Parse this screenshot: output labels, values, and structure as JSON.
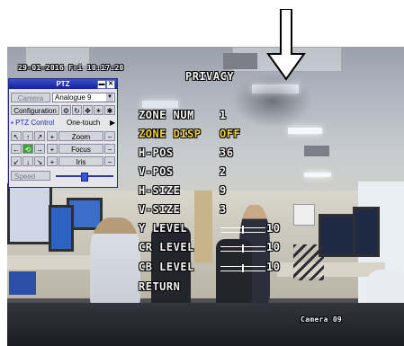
{
  "osd": {
    "datetime": "29-01-2016 Fri 10:17:20",
    "menu_title": "PRIVACY",
    "camera_label": "Camera 09",
    "menu_items": [
      {
        "label": "ZONE NUM",
        "value": "1"
      },
      {
        "label": "ZONE DISP",
        "value": "OFF"
      },
      {
        "label": "H-POS",
        "value": "36"
      },
      {
        "label": "V-POS",
        "value": "2"
      },
      {
        "label": "H-SIZE",
        "value": "9"
      },
      {
        "label": "V-SIZE",
        "value": "3"
      },
      {
        "label": "Y LEVEL",
        "value": "10"
      },
      {
        "label": "CR LEVEL",
        "value": "10"
      },
      {
        "label": "CB LEVEL",
        "value": "10"
      },
      {
        "label": "RETURN",
        "value": ""
      }
    ],
    "highlight_color": "#f2d23a"
  },
  "ptz": {
    "title": "PTZ",
    "camera_label": "Camera",
    "camera_value": "Analogue 9",
    "configuration_label": "Configuration",
    "ptz_control_label": "PTZ Control",
    "one_touch_label": "One-touch",
    "zoom_label": "Zoom",
    "focus_label": "Focus",
    "iris_label": "Iris",
    "speed_label": "Speed",
    "speed_level": 0.5,
    "plus": "+",
    "minus": "−"
  }
}
